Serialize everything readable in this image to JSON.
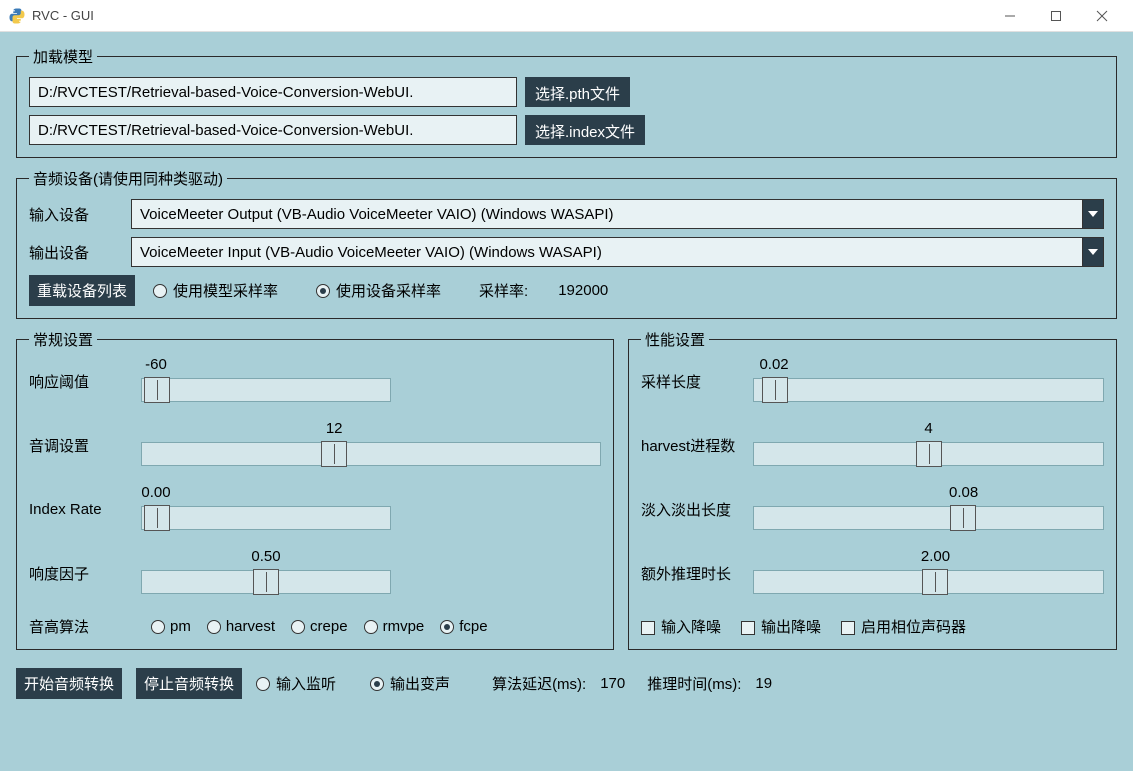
{
  "window": {
    "title": "RVC - GUI"
  },
  "load_model": {
    "legend": "加载模型",
    "pth_path": "D:/RVCTEST/Retrieval-based-Voice-Conversion-WebUI.",
    "index_path": "D:/RVCTEST/Retrieval-based-Voice-Conversion-WebUI.",
    "btn_pth": "选择.pth文件",
    "btn_index": "选择.index文件"
  },
  "audio_dev": {
    "legend": "音频设备(请使用同种类驱动)",
    "input_label": "输入设备",
    "output_label": "输出设备",
    "input_value": "VoiceMeeter Output (VB-Audio VoiceMeeter VAIO) (Windows WASAPI)",
    "output_value": "VoiceMeeter Input (VB-Audio VoiceMeeter VAIO) (Windows WASAPI)",
    "reload_btn": "重载设备列表",
    "sr_model": "使用模型采样率",
    "sr_device": "使用设备采样率",
    "sr_label": "采样率:",
    "sr_value": "192000"
  },
  "general": {
    "legend": "常规设置",
    "threshold_label": "响应阈值",
    "threshold_val": "-60",
    "pitch_label": "音调设置",
    "pitch_val": "12",
    "index_label": "Index Rate",
    "index_val": "0.00",
    "loudness_label": "响度因子",
    "loudness_val": "0.50",
    "algo_label": "音高算法",
    "algo_pm": "pm",
    "algo_harvest": "harvest",
    "algo_crepe": "crepe",
    "algo_rmvpe": "rmvpe",
    "algo_fcpe": "fcpe"
  },
  "perf": {
    "legend": "性能设置",
    "sample_len_label": "采样长度",
    "sample_len_val": "0.02",
    "harvest_label": "harvest进程数",
    "harvest_val": "4",
    "fade_label": "淡入淡出长度",
    "fade_val": "0.08",
    "extra_label": "额外推理时长",
    "extra_val": "2.00",
    "chk_input_denoise": "输入降噪",
    "chk_output_denoise": "输出降噪",
    "chk_phase": "启用相位声码器"
  },
  "bottom": {
    "start_btn": "开始音频转换",
    "stop_btn": "停止音频转换",
    "monitor": "输入监听",
    "output_vc": "输出变声",
    "algo_latency_label": "算法延迟(ms):",
    "algo_latency_val": "170",
    "infer_time_label": "推理时间(ms):",
    "infer_time_val": "19"
  }
}
